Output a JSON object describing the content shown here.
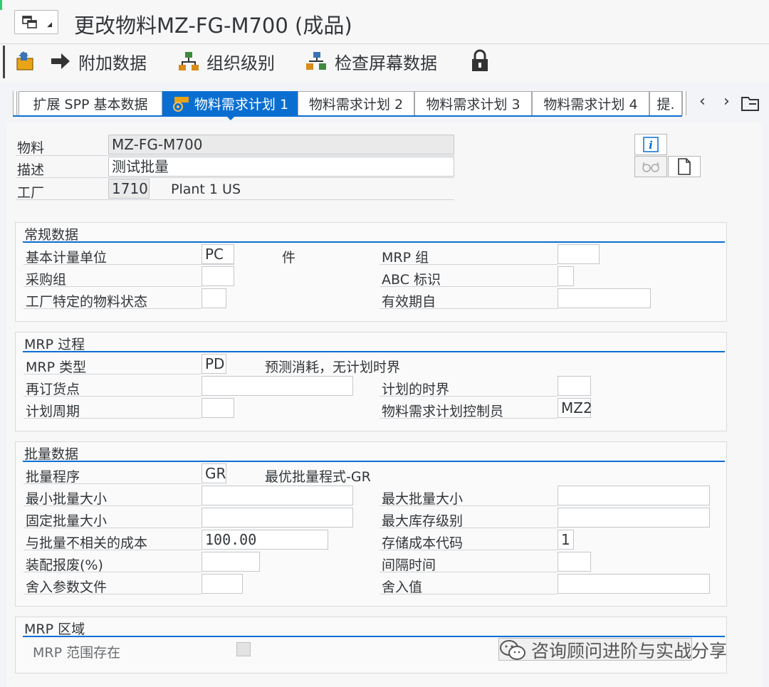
{
  "window": {
    "title": "更改物料MZ-FG-M700 (成品)"
  },
  "toolbar": {
    "additional_data": "附加数据",
    "org_levels": "组织级别",
    "check_screen_data": "检查屏幕数据"
  },
  "tabs": [
    {
      "label": "扩展 SPP 基本数据",
      "active": false
    },
    {
      "label": "物料需求计划 1",
      "active": true
    },
    {
      "label": "物料需求计划 2",
      "active": false
    },
    {
      "label": "物料需求计划 3",
      "active": false
    },
    {
      "label": "物料需求计划 4",
      "active": false
    },
    {
      "label": "提.",
      "active": false
    }
  ],
  "header": {
    "material_label": "物料",
    "material_value": "MZ-FG-M700",
    "description_label": "描述",
    "description_value": "测试批量",
    "plant_label": "工厂",
    "plant_value": "1710",
    "plant_name": "Plant 1 US"
  },
  "general": {
    "title": "常规数据",
    "base_uom_label": "基本计量单位",
    "base_uom_value": "PC",
    "base_uom_text": "件",
    "mrp_group_label": "MRP 组",
    "mrp_group_value": "",
    "purch_group_label": "采购组",
    "purch_group_value": "",
    "abc_label": "ABC 标识",
    "abc_value": "",
    "plant_status_label": "工厂特定的物料状态",
    "plant_status_value": "",
    "valid_from_label": "有效期自",
    "valid_from_value": ""
  },
  "mrp_procedure": {
    "title": "MRP 过程",
    "mrp_type_label": "MRP 类型",
    "mrp_type_value": "PD",
    "mrp_type_text": "预测消耗，无计划时界",
    "reorder_label": "再订货点",
    "reorder_value": "",
    "time_fence_label": "计划的时界",
    "time_fence_value": "",
    "cycle_label": "计划周期",
    "cycle_value": "",
    "controller_label": "物料需求计划控制员",
    "controller_value": "MZ2"
  },
  "lot_size": {
    "title": "批量数据",
    "procedure_label": "批量程序",
    "procedure_value": "GR",
    "procedure_text": "最优批量程式-GR",
    "min_label": "最小批量大小",
    "min_value": "",
    "max_label": "最大批量大小",
    "max_value": "",
    "fixed_label": "固定批量大小",
    "fixed_value": "",
    "max_stock_label": "最大库存级别",
    "max_stock_value": "",
    "ordering_cost_label": "与批量不相关的成本",
    "ordering_cost_value": "100.00",
    "storage_cost_label": "存储成本代码",
    "storage_cost_value": "1",
    "assembly_scrap_label": "装配报废(%)",
    "assembly_scrap_value": "",
    "takt_label": "间隔时间",
    "takt_value": "",
    "rounding_profile_label": "舍入参数文件",
    "rounding_profile_value": "",
    "rounding_value_label": "舍入值",
    "rounding_value_value": ""
  },
  "mrp_area": {
    "title": "MRP 区域",
    "exists_label": "MRP  范围存在"
  },
  "watermark": {
    "text": "咨询顾问进阶与实战分享"
  }
}
